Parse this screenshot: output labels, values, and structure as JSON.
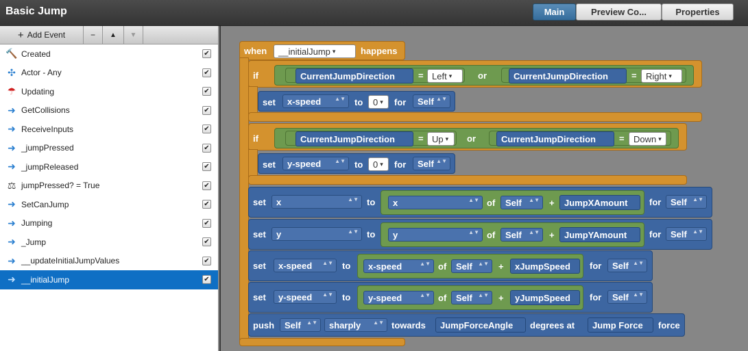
{
  "window": {
    "title": "Basic Jump"
  },
  "tabs": [
    {
      "label": "Main"
    },
    {
      "label": "Preview Co..."
    },
    {
      "label": "Properties"
    }
  ],
  "toolbar": {
    "add_event": "Add Event",
    "remove": "−",
    "up": "▲",
    "down": "▼"
  },
  "events": [
    {
      "label": "Created",
      "icon": "hammer-icon",
      "checked": true
    },
    {
      "label": "Actor - Any",
      "icon": "arrows-icon",
      "checked": true
    },
    {
      "label": "Updating",
      "icon": "umbrella-icon",
      "checked": true
    },
    {
      "label": "GetCollisions",
      "icon": "arrow-right-icon",
      "checked": true
    },
    {
      "label": "ReceiveInputs",
      "icon": "arrow-right-icon",
      "checked": true
    },
    {
      "label": "_jumpPressed",
      "icon": "arrow-right-icon",
      "checked": true
    },
    {
      "label": "_jumpReleased",
      "icon": "arrow-right-icon",
      "checked": true
    },
    {
      "label": "jumpPressed? = True",
      "icon": "condition-icon",
      "checked": true
    },
    {
      "label": "SetCanJump",
      "icon": "arrow-right-icon",
      "checked": true
    },
    {
      "label": "Jumping",
      "icon": "arrow-right-icon",
      "checked": true
    },
    {
      "label": "_Jump",
      "icon": "arrow-right-icon",
      "checked": true
    },
    {
      "label": "__updateInitialJumpValues",
      "icon": "arrow-right-icon",
      "checked": true
    },
    {
      "label": "__initialJump",
      "icon": "arrow-right-icon",
      "checked": true,
      "selected": true
    }
  ],
  "blocks": {
    "when": {
      "kw": "when",
      "event": "__initialJump",
      "tail": "happens"
    },
    "if1": {
      "kw": "if",
      "attr1": "CurrentJumpDirection",
      "eq": "=",
      "val1": "Left",
      "or": "or",
      "attr2": "CurrentJumpDirection",
      "val2": "Right"
    },
    "set1": {
      "kw": "set",
      "var": "x-speed",
      "to": "to",
      "val": "0",
      "for": "for",
      "target": "Self"
    },
    "if2": {
      "kw": "if",
      "attr1": "CurrentJumpDirection",
      "eq": "=",
      "val1": "Up",
      "or": "or",
      "attr2": "CurrentJumpDirection",
      "val2": "Down"
    },
    "set2": {
      "kw": "set",
      "var": "y-speed",
      "to": "to",
      "val": "0",
      "for": "for",
      "target": "Self"
    },
    "setx": {
      "kw": "set",
      "var": "x",
      "to": "to",
      "src": "x",
      "of": "of",
      "target": "Self",
      "plus": "+",
      "add": "JumpXAmount",
      "for": "for",
      "target2": "Self"
    },
    "sety": {
      "kw": "set",
      "var": "y",
      "to": "to",
      "src": "y",
      "of": "of",
      "target": "Self",
      "plus": "+",
      "add": "JumpYAmount",
      "for": "for",
      "target2": "Self"
    },
    "setxs": {
      "kw": "set",
      "var": "x-speed",
      "to": "to",
      "src": "x-speed",
      "of": "of",
      "target": "Self",
      "plus": "+",
      "add": "xJumpSpeed",
      "for": "for",
      "target2": "Self"
    },
    "setys": {
      "kw": "set",
      "var": "y-speed",
      "to": "to",
      "src": "y-speed",
      "of": "of",
      "target": "Self",
      "plus": "+",
      "add": "yJumpSpeed",
      "for": "for",
      "target2": "Self"
    },
    "push": {
      "kw": "push",
      "target": "Self",
      "mode": "sharply",
      "towards": "towards",
      "angle": "JumpForceAngle",
      "deg": "degrees at",
      "force_attr": "Jump Force",
      "force": "force"
    }
  }
}
